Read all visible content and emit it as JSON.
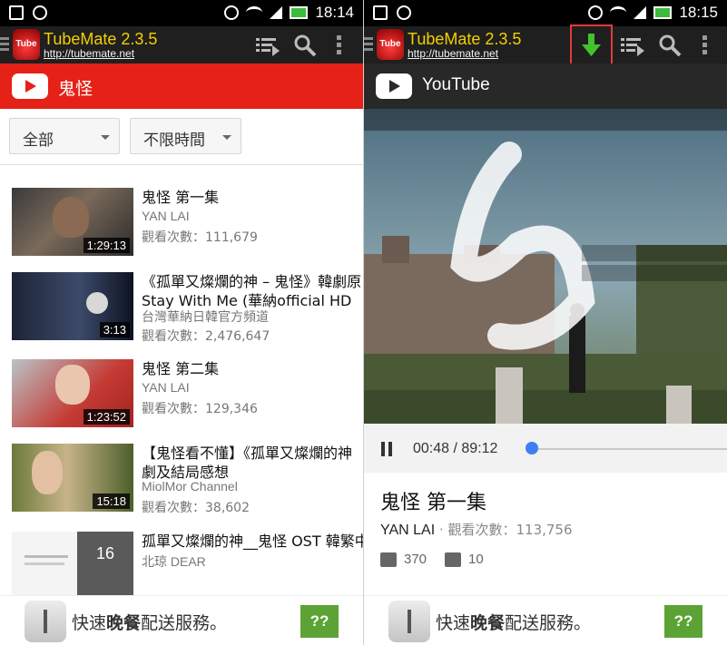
{
  "status_bar": {
    "left_time": "18:14",
    "right_time": "18:15"
  },
  "app": {
    "title": "TubeMate 2.3.5",
    "url": "http://tubemate.net",
    "logo_text": "Tube M"
  },
  "left": {
    "search_query": "鬼怪",
    "filters": {
      "type": "全部",
      "time": "不限時間"
    },
    "videos": [
      {
        "title": "鬼怪 第一集",
        "channel": "YAN LAI",
        "views": "觀看次數：111,679",
        "duration": "1:29:13"
      },
      {
        "title": "《孤單又燦爛的神 – 鬼怪》韓劇原 Stay With Me (華納official HD高畫",
        "channel": "台灣華納日韓官方頻道",
        "views": "觀看次數：2,476,647",
        "duration": "3:13"
      },
      {
        "title": "鬼怪 第二集",
        "channel": "YAN LAI",
        "views": "觀看次數：129,346",
        "duration": "1:23:52"
      },
      {
        "title": "【鬼怪看不懂】《孤單又燦爛的神 劇及結局感想",
        "channel": "MiolMor Channel",
        "views": "觀看次數：38,602",
        "duration": "15:18"
      },
      {
        "title": "孤單又燦爛的神__鬼怪 OST 韓繁中",
        "channel": "北琼 DEAR",
        "views": "",
        "duration": "16"
      }
    ]
  },
  "right": {
    "header_label": "YouTube",
    "player": {
      "elapsed": "00:48",
      "total": "89:12",
      "progress": 0.009
    },
    "video": {
      "title": "鬼怪 第一集",
      "channel": "YAN LAI",
      "views": "觀看次數：113,756",
      "likes": "370",
      "dislikes": "10"
    }
  },
  "ad": {
    "text_pre": "快速",
    "text_bold": "晚餐",
    "text_post": "配送服務。",
    "button": "??"
  }
}
